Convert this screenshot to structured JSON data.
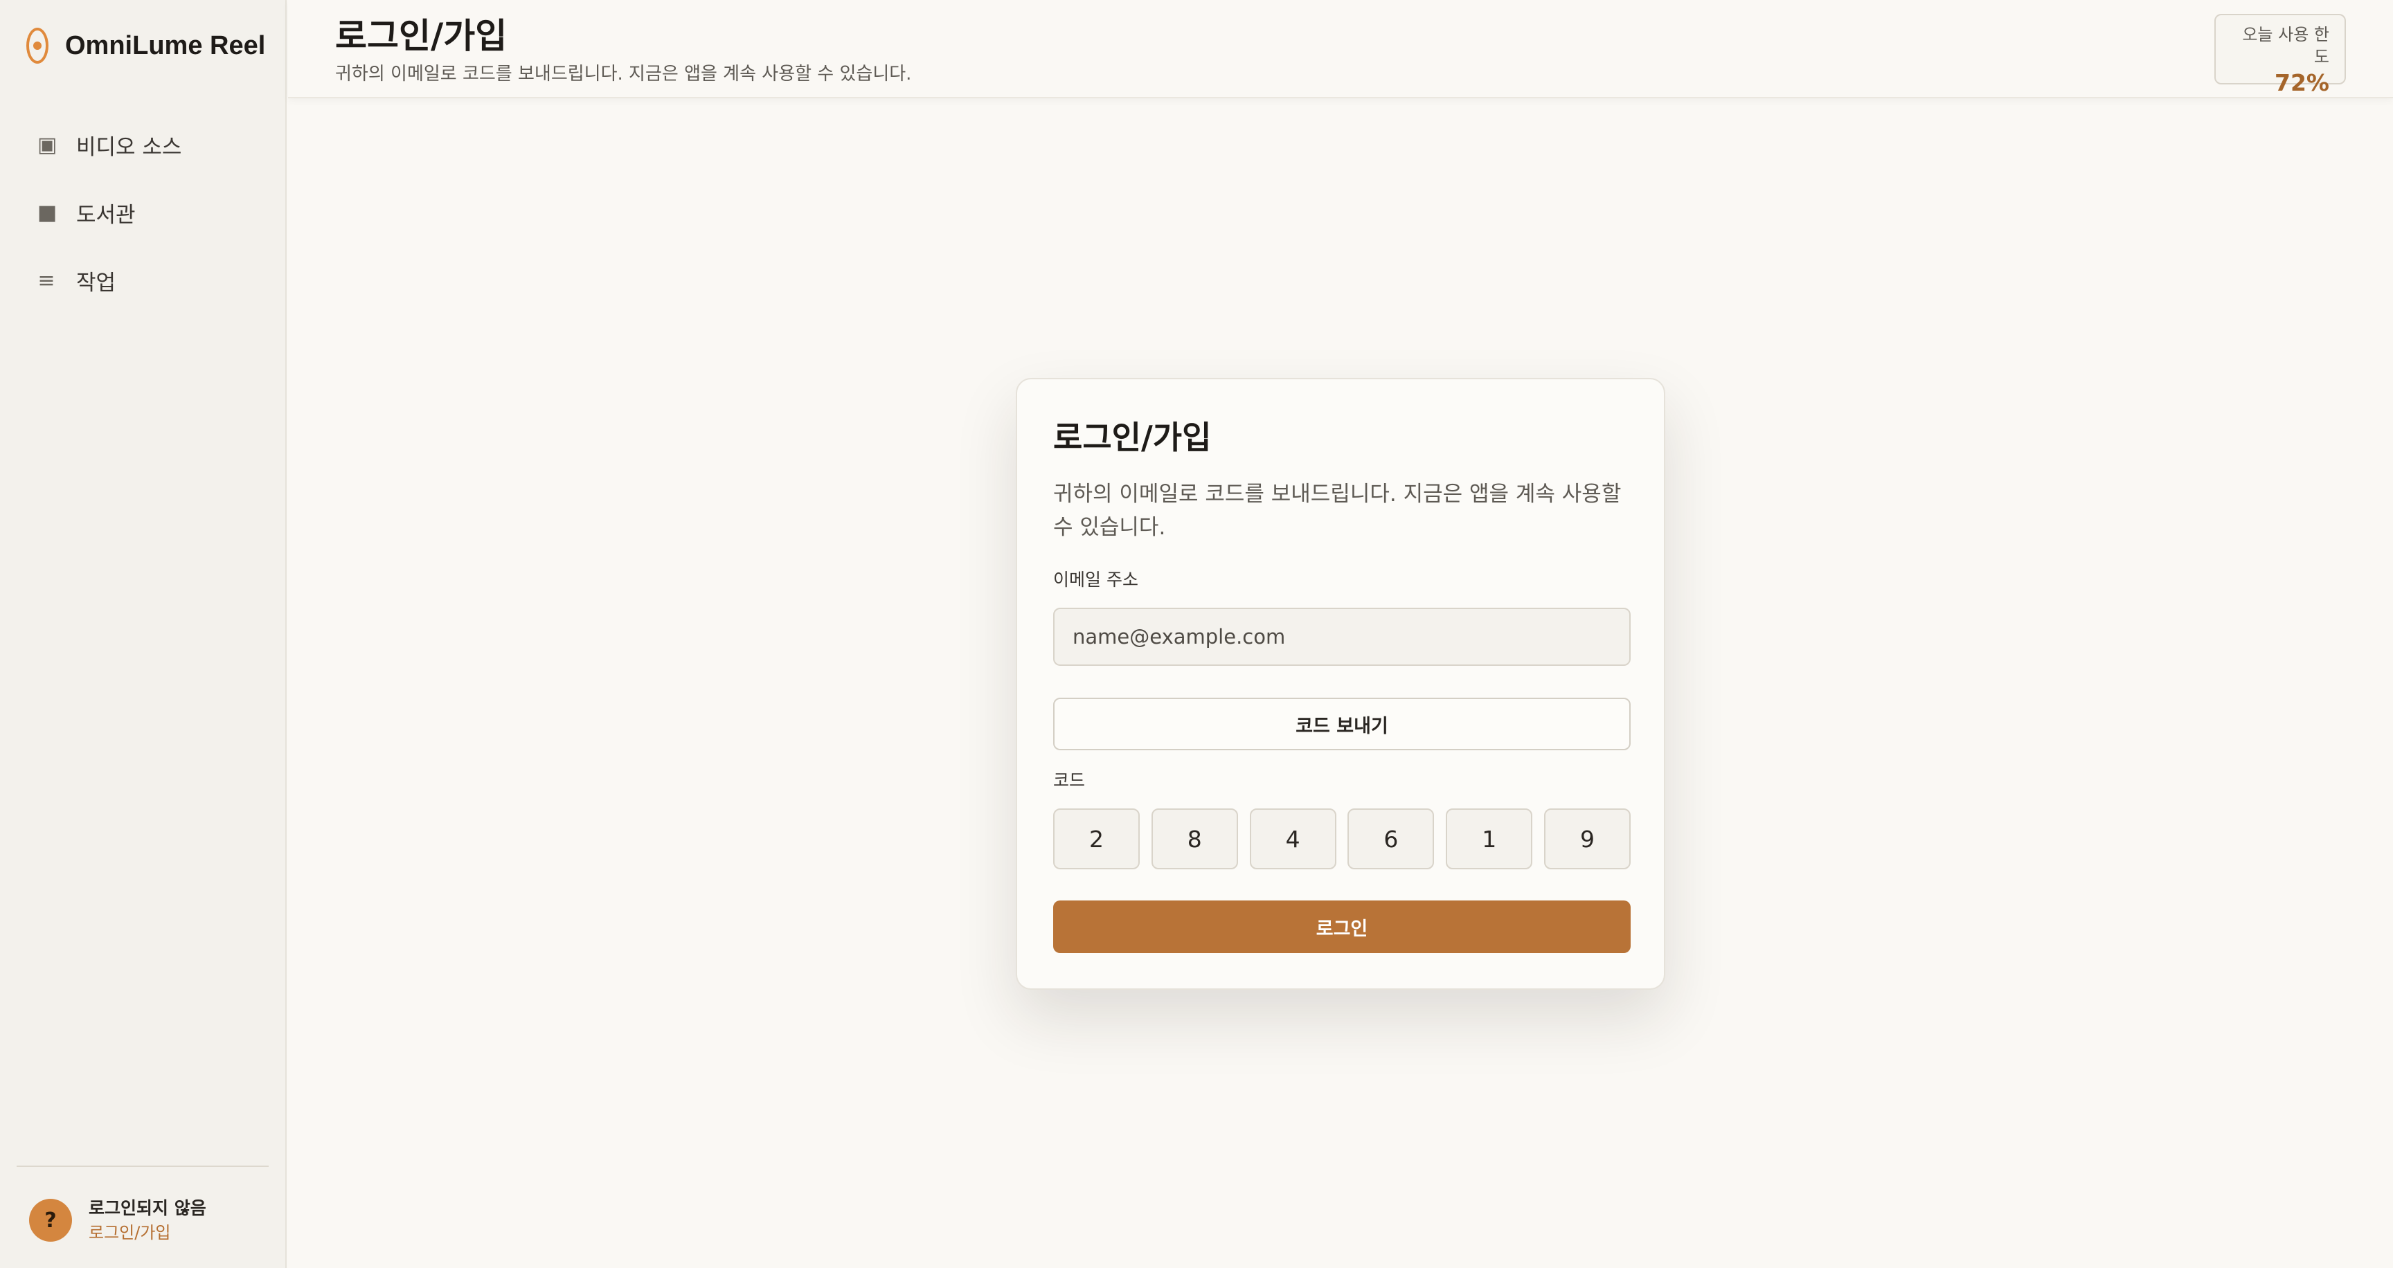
{
  "app": {
    "name": "OmniLume Reel"
  },
  "sidebar": {
    "items": [
      {
        "icon": "video-source-icon",
        "glyph": "▣",
        "label": "비디오 소스"
      },
      {
        "icon": "library-icon",
        "glyph": "■",
        "label": "도서관"
      },
      {
        "icon": "jobs-icon",
        "glyph": "≡",
        "label": "작업"
      }
    ],
    "user": {
      "avatar_glyph": "?",
      "status": "로그인되지 않음",
      "login_link": "로그인/가입"
    }
  },
  "header": {
    "title": "로그인/가입",
    "subtitle": "귀하의 이메일로 코드를 보내드립니다. 지금은 앱을 계속 사용할 수 있습니다.",
    "quota": {
      "label": "오늘 사용 한도",
      "value": "72%"
    }
  },
  "login_card": {
    "title": "로그인/가입",
    "description": "귀하의 이메일로 코드를 보내드립니다. 지금은 앱을 계속 사용할 수 있습니다.",
    "email_label": "이메일 주소",
    "email_placeholder": "name@example.com",
    "email_value": "",
    "send_code_label": "코드 보내기",
    "code_label": "코드",
    "code_digits": [
      "2",
      "8",
      "4",
      "6",
      "1",
      "9"
    ],
    "login_label": "로그인"
  },
  "colors": {
    "accent": "#b87337",
    "avatar": "#d4863f",
    "quota_value": "#a5652a",
    "background": "#faf8f4",
    "sidebar": "#f3f1ec"
  }
}
